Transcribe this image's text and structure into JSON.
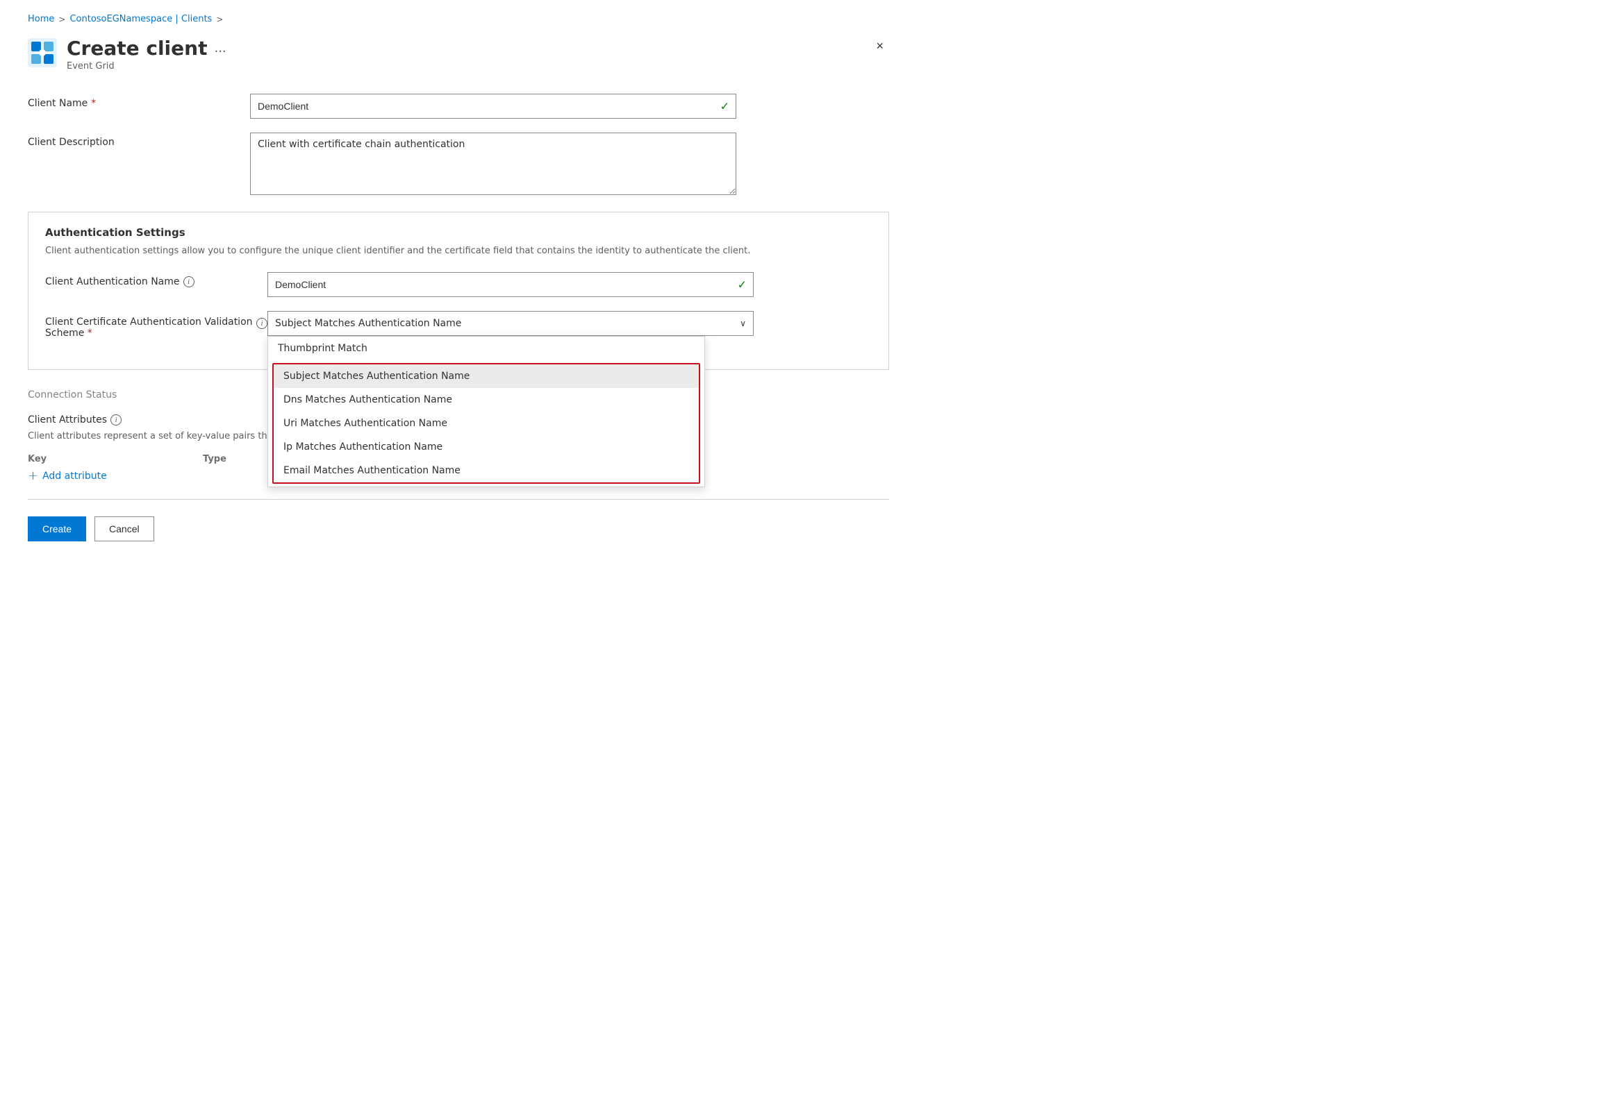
{
  "breadcrumb": {
    "home": "Home",
    "namespace": "ContosoEGNamespace | Clients",
    "sep1": ">",
    "sep2": ">"
  },
  "header": {
    "title": "Create client",
    "ellipsis": "...",
    "subtitle": "Event Grid",
    "close_label": "×"
  },
  "form": {
    "client_name_label": "Client Name",
    "client_name_required": "*",
    "client_name_value": "DemoClient",
    "client_description_label": "Client Description",
    "client_description_value": "Client with certificate chain authentication"
  },
  "auth_settings": {
    "title": "Authentication Settings",
    "description": "Client authentication settings allow you to configure the unique client identifier and the certificate field that contains the identity to authenticate the client.",
    "auth_name_label": "Client Authentication Name",
    "auth_name_info": "i",
    "auth_name_value": "DemoClient",
    "scheme_label": "Client Certificate Authentication Validation Scheme",
    "scheme_required": "*",
    "scheme_info": "i",
    "scheme_selected": "Subject Matches Authentication Name",
    "dropdown_options": [
      {
        "value": "thumbprint",
        "label": "Thumbprint Match",
        "selected": false,
        "highlighted": false
      },
      {
        "value": "subject",
        "label": "Subject Matches Authentication Name",
        "selected": true,
        "highlighted": true
      },
      {
        "value": "dns",
        "label": "Dns Matches Authentication Name",
        "selected": false,
        "highlighted": true
      },
      {
        "value": "uri",
        "label": "Uri Matches Authentication Name",
        "selected": false,
        "highlighted": true
      },
      {
        "value": "ip",
        "label": "Ip Matches Authentication Name",
        "selected": false,
        "highlighted": true
      },
      {
        "value": "email",
        "label": "Email Matches Authentication Name",
        "selected": false,
        "highlighted": true
      }
    ]
  },
  "connection_status": {
    "label": "Connection Status"
  },
  "client_attributes": {
    "label": "Client Attributes",
    "info": "i",
    "description": "Client attributes represent a set of key-value pairs that can be used to filter clients based on common attribute values.",
    "col_key": "Key",
    "col_type": "Type",
    "add_label": "Add attribute"
  },
  "footer": {
    "create_label": "Create",
    "cancel_label": "Cancel"
  }
}
